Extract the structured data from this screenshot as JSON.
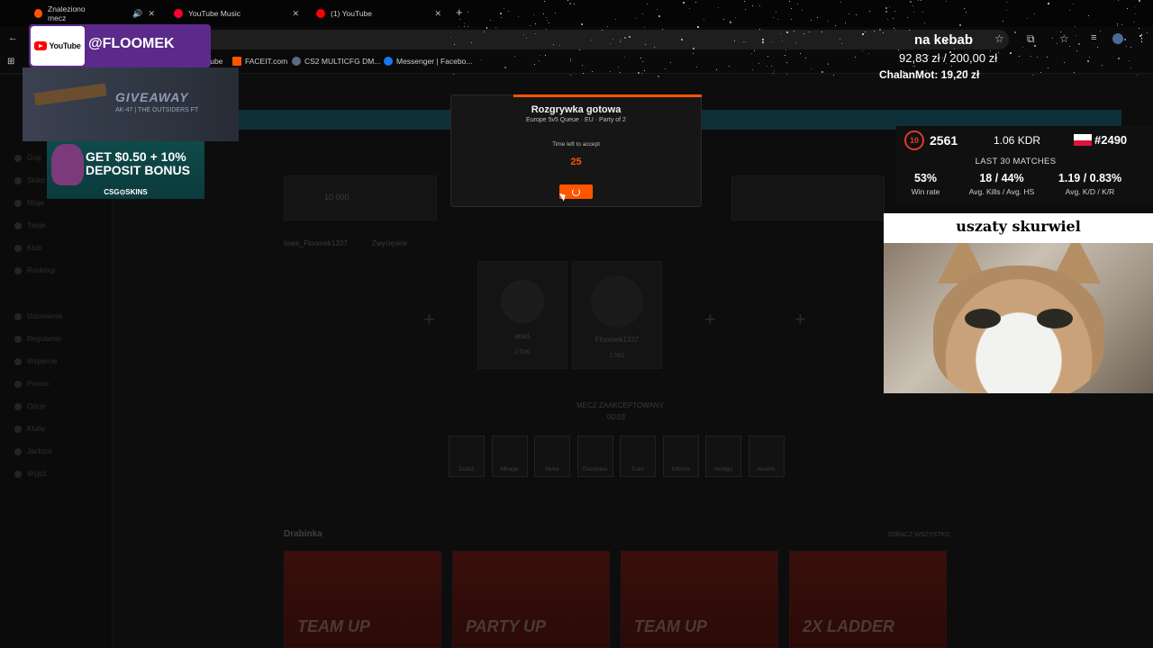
{
  "browser": {
    "tabs": [
      {
        "label": "Znaleziono mecz",
        "color": "#ff5500"
      },
      {
        "label": "YouTube Music",
        "color": "#ff0033"
      },
      {
        "label": "(1) YouTube",
        "color": "#ff0000"
      }
    ],
    "new_tab": "+",
    "bookmarks": [
      "YouTube",
      "FACEIT.com",
      "CS2 MULTICFG DM...",
      "Messenger | Facebo..."
    ]
  },
  "overlay": {
    "yt_brand": "YouTube",
    "handle": "@FLOOMEK",
    "giveaway_title": "GIVEAWAY",
    "giveaway_sub": "AK-47 | THE OUTSIDERS FT",
    "deposit_line1": "GET $0.50 + 10%",
    "deposit_line2": "DEPOSIT BONUS",
    "deposit_brand": "CSG⊙SKINS",
    "goal_title": "na kebab",
    "goal_amount": "92,83 zł / 200,00 zł",
    "last_donor": "ChalanMot: 19,20 zł",
    "cat_caption": "uszaty skurwiel"
  },
  "stats": {
    "level": "10",
    "elo": "2561",
    "kdr": "1.06 KDR",
    "rank": "#2490",
    "last_matches_label": "LAST 30 MATCHES",
    "items": [
      {
        "value": "53%",
        "label": "Win rate"
      },
      {
        "value": "18 / 44%",
        "label": "Avg. Kills / Avg. HS"
      },
      {
        "value": "1.19 / 0.83%",
        "label": "Avg. K/D / K/R"
      }
    ],
    "flag_colors": {
      "top": "#ffffff",
      "bottom": "#dc143c"
    }
  },
  "modal": {
    "title": "Rozgrywka gotowa",
    "subtitle": "Europe 5v5 Queue · EU · Party of 2",
    "time_label": "Time left to accept",
    "countdown": "25",
    "accent": "#ff5500"
  },
  "page": {
    "nav_items": [
      "Graj",
      "Sklep",
      "Misje",
      "Twoje",
      "Klub",
      "Rankingi",
      "Ustawienia",
      "Regulamin",
      "Wsparcie",
      "Pomoc",
      "Opcje",
      "Kluby",
      "Jackpot",
      "Wyjdź"
    ],
    "card_value": "10 000.",
    "team_name": "team_Floomek1337",
    "team_status": "Zwycięskie",
    "players": [
      {
        "name": "ana1",
        "elo": "2.536"
      },
      {
        "name": "Floomek1337",
        "elo": "2.561"
      }
    ],
    "match_status": "MECZ ZAAKCEPTOWANY",
    "match_timer": "00:03",
    "maps": [
      "Dust2",
      "Mirage",
      "Nuke",
      "Overpass",
      "Train",
      "Inferno",
      "Vertigo",
      "Anubis"
    ],
    "ladder_title": "Drabinka",
    "ladder_link": "ZOBACZ WSZYSTKO",
    "promos": [
      "TEAM UP",
      "PARTY UP",
      "TEAM UP",
      "2X LADDER"
    ]
  }
}
